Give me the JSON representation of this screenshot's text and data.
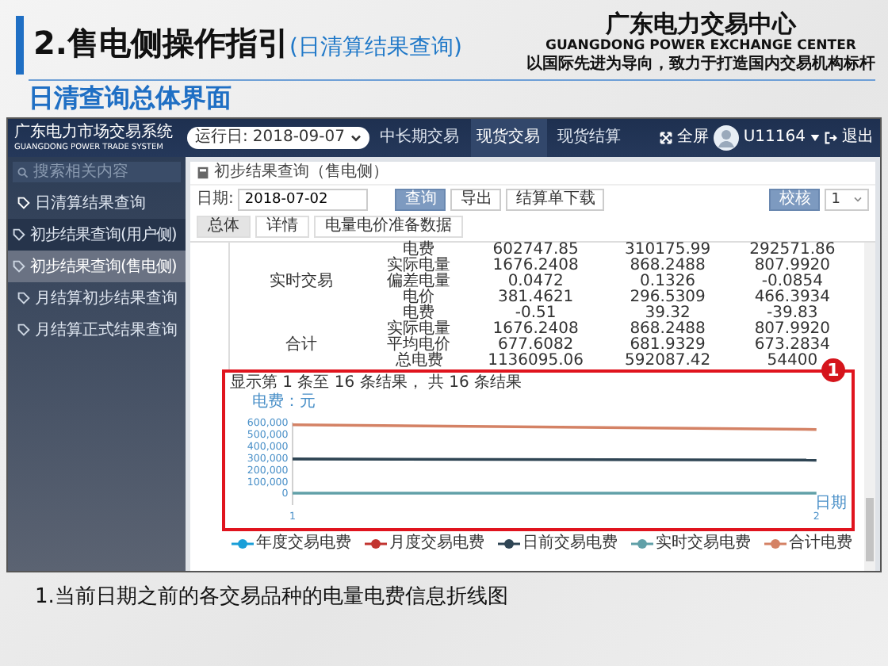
{
  "slide": {
    "title": "2.售电侧操作指引",
    "title_note": "(日清算结果查询)",
    "org_name": "广东电力交易中心",
    "org_name_en": "GUANGDONG POWER EXCHANGE CENTER",
    "org_slogan": "以国际先进为导向，致力于打造国内交易机构标杆",
    "subtitle": "日清查询总体界面",
    "caption": "1.当前日期之前的各交易品种的电量电费信息折线图"
  },
  "app": {
    "logo": "广东电力市场交易系统",
    "logo_en": "GUANGDONG POWER TRADE SYSTEM",
    "run_day_label": "运行日:",
    "run_day": "2018-09-07",
    "nav": [
      {
        "label": "中长期交易",
        "selected": false
      },
      {
        "label": "现货交易",
        "selected": true
      },
      {
        "label": "现货结算",
        "selected": false
      }
    ],
    "fullscreen": "全屏",
    "user": "U11164",
    "logout": "退出"
  },
  "sidebar": {
    "search_placeholder": "搜索相关内容",
    "items": [
      {
        "label": "日清算结果查询",
        "expanded": true,
        "selected": false,
        "children": [
          {
            "label": "初步结果查询(用户侧)",
            "selected": false
          },
          {
            "label": "初步结果查询(售电侧)",
            "selected": true
          }
        ]
      },
      {
        "label": "月结算初步结果查询",
        "expanded": false,
        "selected": false
      },
      {
        "label": "月结算正式结果查询",
        "expanded": false,
        "selected": false
      }
    ]
  },
  "panel": {
    "title": "初步结果查询（售电侧）",
    "date_label": "日期:",
    "date": "2018-07-02",
    "buttons": [
      {
        "label": "查询",
        "kind": "primary"
      },
      {
        "label": "导出",
        "kind": "default"
      },
      {
        "label": "结算单下载",
        "kind": "default"
      }
    ],
    "check_button": "校核",
    "page_select": "1",
    "tabs": [
      {
        "label": "总体",
        "selected": true
      },
      {
        "label": "详情",
        "selected": false
      },
      {
        "label": "电量电价准备数据",
        "selected": false
      }
    ]
  },
  "table": {
    "groups": [
      {
        "label": "实时交易",
        "rows": [
          {
            "item": "电费",
            "values": [
              "602747.85",
              "310175.99",
              "292571.86"
            ]
          },
          {
            "item": "实际电量",
            "values": [
              "1676.2408",
              "868.2488",
              "807.9920"
            ]
          },
          {
            "item": "偏差电量",
            "values": [
              "0.0472",
              "0.1326",
              "-0.0854"
            ]
          },
          {
            "item": "电价",
            "values": [
              "381.4621",
              "296.5309",
              "466.3934"
            ]
          },
          {
            "item": "电费",
            "values": [
              "-0.51",
              "39.32",
              "-39.83"
            ]
          }
        ]
      },
      {
        "label": "合计",
        "rows": [
          {
            "item": "实际电量",
            "values": [
              "1676.2408",
              "868.2488",
              "807.9920"
            ]
          },
          {
            "item": "平均电价",
            "values": [
              "677.6082",
              "681.9329",
              "673.2834"
            ]
          },
          {
            "item": "总电费",
            "values": [
              "1136095.06",
              "592087.42",
              "54400"
            ]
          }
        ]
      }
    ]
  },
  "results_info": "显示第 1 条至 16 条结果， 共 16 条结果",
  "annotation": {
    "badge": "1"
  },
  "chart_data": {
    "type": "line",
    "ylabel": "电费：元",
    "xlabel": "日期",
    "x": [
      "1",
      "2"
    ],
    "ylim": [
      -100000,
      600000
    ],
    "yticks": [
      {
        "value": 0,
        "label": "0"
      },
      {
        "value": 100000,
        "label": "100,000"
      },
      {
        "value": 200000,
        "label": "200,000"
      },
      {
        "value": 300000,
        "label": "300,000"
      },
      {
        "value": 400000,
        "label": "400,000"
      },
      {
        "value": 500000,
        "label": "500,000"
      },
      {
        "value": 600000,
        "label": "600,000"
      }
    ],
    "series": [
      {
        "name": "年度交易电费",
        "color": "#1a9fd8",
        "values": [
          null,
          null
        ]
      },
      {
        "name": "月度交易电费",
        "color": "#c23531",
        "values": [
          null,
          null
        ]
      },
      {
        "name": "日前交易电费",
        "color": "#2f4554",
        "values": [
          290000,
          280000
        ]
      },
      {
        "name": "实时交易电费",
        "color": "#61a0a8",
        "values": [
          0,
          0
        ]
      },
      {
        "name": "合计电费",
        "color": "#d48265",
        "values": [
          580000,
          540000
        ]
      }
    ]
  }
}
